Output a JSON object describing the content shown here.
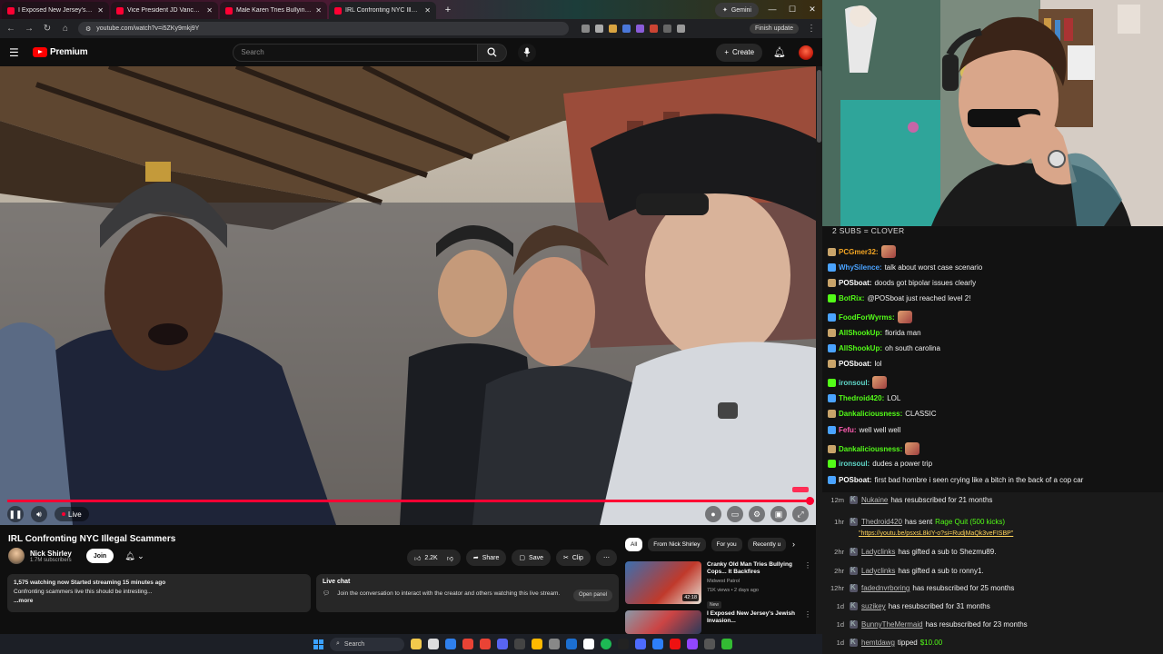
{
  "browser": {
    "tabs": [
      {
        "label": "I Exposed New Jersey's Jewish",
        "active": false
      },
      {
        "label": "Vice President JD Vance Deliver",
        "active": false
      },
      {
        "label": "Male Karen Tries Bullying Offic",
        "active": false
      },
      {
        "label": "IRL Confronting NYC Illegal",
        "active": true
      }
    ],
    "gemini_label": "Gemini",
    "url": "youtube.com/watch?v=i5ZKy9mkj9Y",
    "finish_update": "Finish update"
  },
  "youtube": {
    "logo_text": "Premium",
    "search_placeholder": "Search",
    "create_label": "Create",
    "player": {
      "live_label": "Live",
      "progress": 1.0
    },
    "video_title": "IRL Confronting NYC Illegal Scammers",
    "channel_name": "Nick Shirley",
    "channel_subs": "1.7M subscribers",
    "join_label": "Join",
    "actions": {
      "likes": "2.2K",
      "share": "Share",
      "save": "Save",
      "clip": "Clip"
    },
    "description": {
      "stats": "1,575 watching now  Started streaming 15 minutes ago",
      "text": "Confronting scammers live this should be intresting...",
      "more": "...more"
    },
    "live_chat": {
      "title": "Live chat",
      "text": "Join the conversation to interact with the creator and others watching this live stream.",
      "open_panel": "Open panel"
    },
    "chips": [
      "All",
      "From Nick Shirley",
      "For you",
      "Recently u"
    ],
    "recommendations": [
      {
        "title": "Cranky Old Man Tries Bullying Cops... It Backfires",
        "channel": "Midwest Patrol",
        "meta": "71K views • 2 days ago",
        "badge": "New",
        "duration": "42:18"
      },
      {
        "title": "I Exposed New Jersey's Jewish Invasion...",
        "channel": "",
        "meta": "",
        "badge": "",
        "duration": ""
      }
    ]
  },
  "taskbar": {
    "search_label": "Search"
  },
  "stream_chat": {
    "sub_goal": "2 SUBS = CLOVER",
    "messages": [
      {
        "user": "PCGmer32:",
        "text": "",
        "color": "#f5a623",
        "emote": true
      },
      {
        "user": "WhySilence:",
        "text": "talk about worst case scenario",
        "color": "#4aa3ff",
        "emote": false
      },
      {
        "user": "POSboat:",
        "text": "doods got bipolar issues clearly",
        "color": "#ffffff",
        "emote": false
      },
      {
        "user": "BotRix:",
        "text": "@POSboat just reached level 2!",
        "color": "#53fc18",
        "emote": false
      },
      {
        "user": "FoodForWyrms:",
        "text": "",
        "color": "#53fc18",
        "emote": true
      },
      {
        "user": "AllShookUp:",
        "text": "florida man",
        "color": "#53fc18",
        "emote": false
      },
      {
        "user": "AllShookUp:",
        "text": "oh south carolina",
        "color": "#53fc18",
        "emote": false
      },
      {
        "user": "POSboat:",
        "text": "lol",
        "color": "#ffffff",
        "emote": false
      },
      {
        "user": "ironsoul:",
        "text": "",
        "color": "#5fd7c8",
        "emote": true
      },
      {
        "user": "Thedroid420:",
        "text": "LOL",
        "color": "#53fc18",
        "emote": false
      },
      {
        "user": "Dankaliciousness:",
        "text": "CLASSIC",
        "color": "#53fc18",
        "emote": false
      },
      {
        "user": "Fefu:",
        "text": "well well well",
        "color": "#ff5db1",
        "emote": false
      },
      {
        "user": "Dankaliciousness:",
        "text": "",
        "color": "#53fc18",
        "emote": true
      },
      {
        "user": "ironsoul:",
        "text": "dudes a power trip",
        "color": "#5fd7c8",
        "emote": false
      },
      {
        "user": "POSboat:",
        "text": "first bad hombre i seen crying like a bitch in the back of a cop car",
        "color": "#ffffff",
        "emote": false
      }
    ],
    "alerts": [
      {
        "time": "12m",
        "user": "Nukaine",
        "text": "has resubscribed for 21 months"
      },
      {
        "time": "1hr",
        "user": "Thedroid420",
        "text": "has sent",
        "highlight": "Rage Quit (500 kicks)",
        "link": "\"https://youtu.be/psxsL8kIY-o?si=RudjMaQk3veFISBP\""
      },
      {
        "time": "2hr",
        "user": "Ladyclinks",
        "text": "has gifted a sub to Shezmu89."
      },
      {
        "time": "2hr",
        "user": "Ladyclinks",
        "text": "has gifted a sub to ronny1."
      },
      {
        "time": "12hr",
        "user": "fadednvrboring",
        "text": "has resubscribed for 25 months"
      },
      {
        "time": "1d",
        "user": "suzikey",
        "text": "has resubscribed for 31 months"
      },
      {
        "time": "1d",
        "user": "BunnyTheMermaid",
        "text": "has resubscribed for 23 months"
      },
      {
        "time": "1d",
        "user": "hemtdawg",
        "text": "tipped",
        "highlight": "$10.00"
      }
    ]
  }
}
